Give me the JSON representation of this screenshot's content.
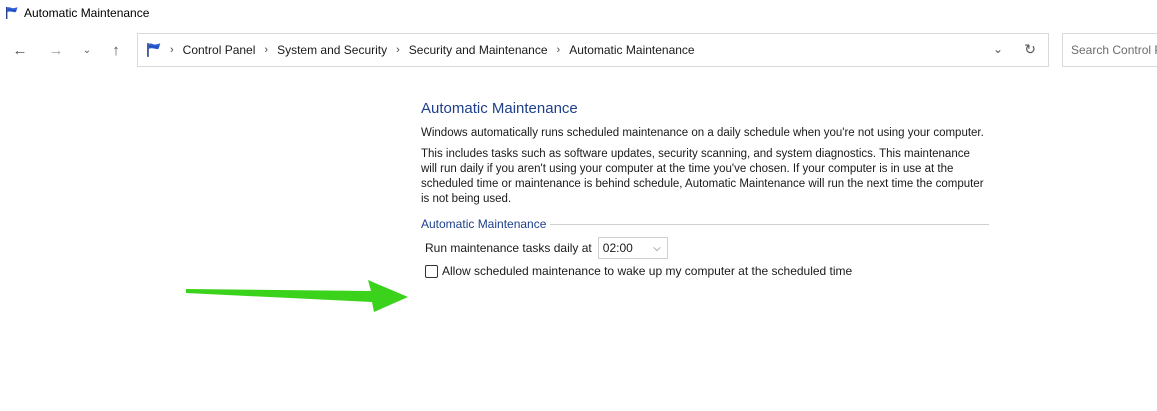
{
  "window": {
    "title": "Automatic Maintenance",
    "icon": "control-panel-flag-icon"
  },
  "navigation": {
    "back_icon": "←",
    "forward_icon": "→",
    "recent_icon": "⌄",
    "up_icon": "↑"
  },
  "address_bar": {
    "breadcrumbs": [
      "Control Panel",
      "System and Security",
      "Security and Maintenance",
      "Automatic Maintenance"
    ],
    "dropdown_icon": "⌄",
    "refresh_icon": "↻"
  },
  "search": {
    "placeholder": "Search Control P"
  },
  "main": {
    "heading": "Automatic Maintenance",
    "paragraph1": "Windows automatically runs scheduled maintenance on a daily schedule when you're not using your computer.",
    "paragraph2": "This includes tasks such as software updates, security scanning, and system diagnostics. This maintenance will run daily if you aren't using your computer at the time you've chosen. If your computer is in use at the scheduled time or maintenance is behind schedule, Automatic Maintenance will run the next time the computer is not being used.",
    "group_title": "Automatic Maintenance",
    "run_label": "Run maintenance tasks daily at",
    "time_value": "02:00",
    "wake_label": "Allow scheduled maintenance to wake up my computer at the scheduled time",
    "wake_checked": false
  },
  "colors": {
    "heading": "#1e3f8a",
    "arrow": "#3ad21a"
  }
}
